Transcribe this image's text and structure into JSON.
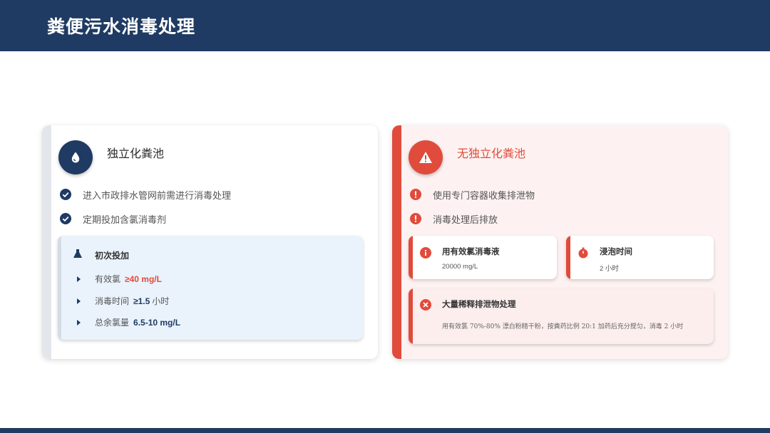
{
  "header": {
    "title": "粪便污水消毒处理"
  },
  "left_card": {
    "icon": "water-drop-icon",
    "title": "独立化粪池",
    "checks": [
      {
        "icon": "check-circle-icon",
        "text": "进入市政排水管网前需进行消毒处理"
      },
      {
        "icon": "check-circle-icon",
        "text": "定期投加含氯消毒剂"
      }
    ],
    "sub_box": {
      "icon": "flask-icon",
      "title": "初次投加",
      "lines": [
        {
          "label": "有效氯",
          "value": "≥40 mg/L",
          "unit": ""
        },
        {
          "label": "消毒时间",
          "value": "≥1.5",
          "unit": "小时"
        },
        {
          "label": "总余氯量",
          "value": "6.5-10 mg/L",
          "unit": ""
        }
      ]
    }
  },
  "right_card": {
    "icon": "warning-triangle-icon",
    "title": "无独立化粪池",
    "alerts": [
      {
        "icon": "exclamation-circle-icon",
        "text": "使用专门容器收集排泄物"
      },
      {
        "icon": "exclamation-circle-icon",
        "text": "消毒处理后排放"
      }
    ],
    "mini_cards": [
      {
        "icon": "info-circle-icon",
        "title": "用有效氯消毒液",
        "text": "20000 mg/L"
      },
      {
        "icon": "stopwatch-icon",
        "title": "浸泡时间",
        "text": "2 小时"
      }
    ],
    "wide_card": {
      "icon": "x-circle-icon",
      "title": "大量稀释排泄物处理",
      "text": "用有效氯 70%-80% 漂白粉精干粉，按粪药比例 20:1 加药后充分搅匀，消毒 2 小时"
    }
  },
  "colors": {
    "navy": "#1f3b63",
    "red": "#e14b3c",
    "light_blue": "#eaf3fc",
    "light_pink": "#fdf2f1"
  }
}
